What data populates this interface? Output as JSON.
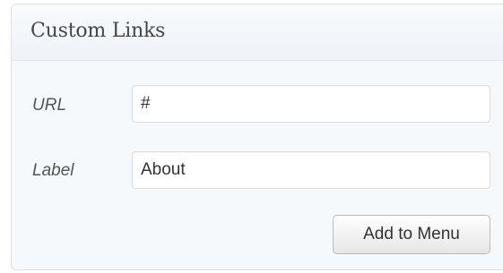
{
  "panel": {
    "title": "Custom Links"
  },
  "form": {
    "url": {
      "label": "URL",
      "value": "#"
    },
    "link_label": {
      "label": "Label",
      "value": "About"
    },
    "submit_label": "Add to Menu"
  },
  "colors": {
    "panel_background": "#f5f9fc",
    "border": "#dfdfdf",
    "title_text": "#464646",
    "label_text": "#555555"
  }
}
